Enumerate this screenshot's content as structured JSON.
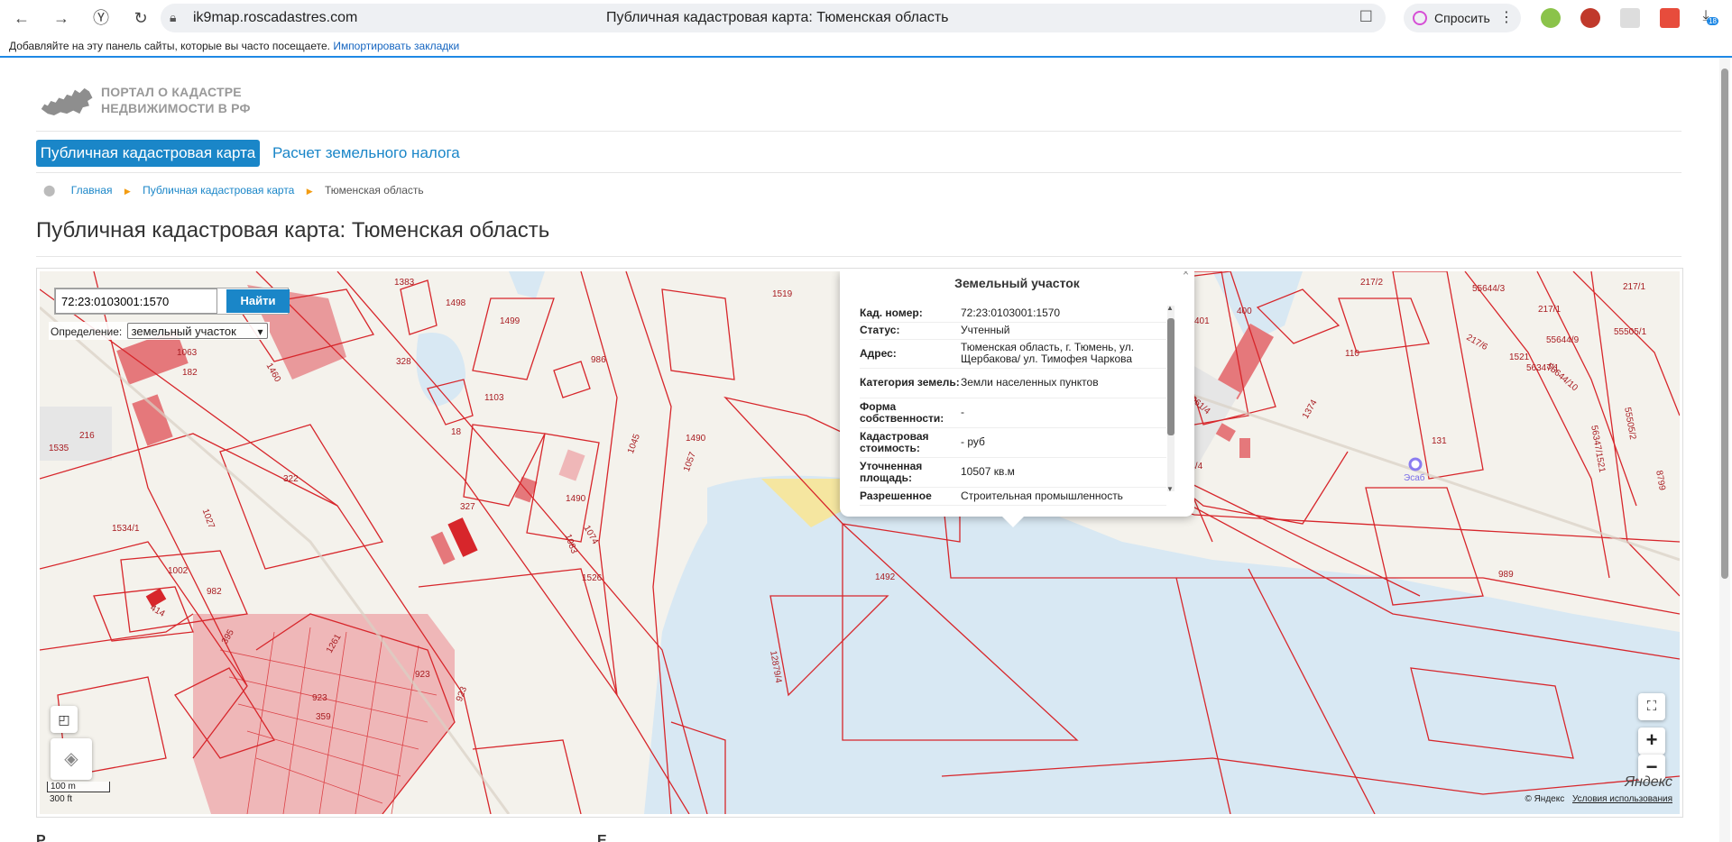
{
  "browser": {
    "url": "ik9map.roscadastres.com",
    "tab_title": "Публичная кадастровая карта: Тюменская область",
    "ask_label": "Спросить",
    "downloads_badge": "18",
    "bookmarks_prompt": "Добавляйте на эту панель сайты, которые вы часто посещаете.",
    "bookmarks_import": "Импортировать закладки"
  },
  "header": {
    "logo_line1": "ПОРТАЛ О КАДАСТРЕ",
    "logo_line2": "НЕДВИЖИМОСТИ В РФ"
  },
  "nav": {
    "tab_map": "Публичная кадастровая карта",
    "tab_tax": "Расчет земельного налога"
  },
  "breadcrumb": {
    "home": "Главная",
    "map": "Публичная кадастровая карта",
    "current": "Тюменская область"
  },
  "page": {
    "title": "Публичная кадастровая карта: Тюменская область"
  },
  "map": {
    "search_value": "72:23:0103001:1570",
    "search_button": "Найти",
    "definition_label": "Определение:",
    "definition_value": "земельный участок",
    "scale_m": "100 m",
    "scale_ft": "300 ft",
    "copyright": "© Яндекс",
    "terms": "Условия использования",
    "logo": "Яндекс",
    "poi": "Эсаб",
    "labels": [
      {
        "t": "1383"
      },
      {
        "t": "1498"
      },
      {
        "t": "1499"
      },
      {
        "t": "986"
      },
      {
        "t": "1519"
      },
      {
        "t": "1063"
      },
      {
        "t": "182"
      },
      {
        "t": "1460"
      },
      {
        "t": "328"
      },
      {
        "t": "1103"
      },
      {
        "t": "216"
      },
      {
        "t": "1535"
      },
      {
        "t": "18"
      },
      {
        "t": "1490"
      },
      {
        "t": "1045"
      },
      {
        "t": "1057"
      },
      {
        "t": "322"
      },
      {
        "t": "1027"
      },
      {
        "t": "327"
      },
      {
        "t": "1490"
      },
      {
        "t": "1534/1"
      },
      {
        "t": "1074"
      },
      {
        "t": "1083"
      },
      {
        "t": "1526"
      },
      {
        "t": "1002"
      },
      {
        "t": "982"
      },
      {
        "t": "414"
      },
      {
        "t": "395"
      },
      {
        "t": "1261"
      },
      {
        "t": "923"
      },
      {
        "t": "923"
      },
      {
        "t": "359"
      },
      {
        "t": "923"
      },
      {
        "t": "1492"
      },
      {
        "t": "12879/4"
      },
      {
        "t": "401"
      },
      {
        "t": "400"
      },
      {
        "t": "110"
      },
      {
        "t": "217/2"
      },
      {
        "t": "55644/3"
      },
      {
        "t": "217/1"
      },
      {
        "t": "217/1"
      },
      {
        "t": "217/6"
      },
      {
        "t": "55644/9"
      },
      {
        "t": "55505/1"
      },
      {
        "t": "1521"
      },
      {
        "t": "56347/1"
      },
      {
        "t": "55644/10"
      },
      {
        "t": "1061/4"
      },
      {
        "t": "1374"
      },
      {
        "t": "131"
      },
      {
        "t": "55644/4"
      },
      {
        "t": "989"
      },
      {
        "t": "56347/1521"
      },
      {
        "t": "55505/2"
      },
      {
        "t": "8799"
      }
    ]
  },
  "popup": {
    "title": "Земельный участок",
    "rows": [
      {
        "k": "Кад. номер:",
        "v": "72:23:0103001:1570"
      },
      {
        "k": "Статус:",
        "v": "Учтенный"
      },
      {
        "k": "Адрес:",
        "v": "Тюменская область, г. Тюмень, ул. Щербакова/ ул. Тимофея Чаркова"
      },
      {
        "k": "Категория земель:",
        "v": "Земли населенных пунктов"
      },
      {
        "k": "Форма собственности:",
        "v": "-"
      },
      {
        "k": "Кадастровая стоимость:",
        "v": "- руб"
      },
      {
        "k": "Уточненная площадь:",
        "v": "10507 кв.м"
      },
      {
        "k": "Разрешенное",
        "v": "Строительная промышленность"
      }
    ]
  },
  "bottom": {
    "left": "Р",
    "right": "Е"
  },
  "colors": {
    "accent": "#1a86c8",
    "parcel_line": "#d7262b",
    "parcel_fill": "#e5787b",
    "water": "#cfe3f1"
  }
}
